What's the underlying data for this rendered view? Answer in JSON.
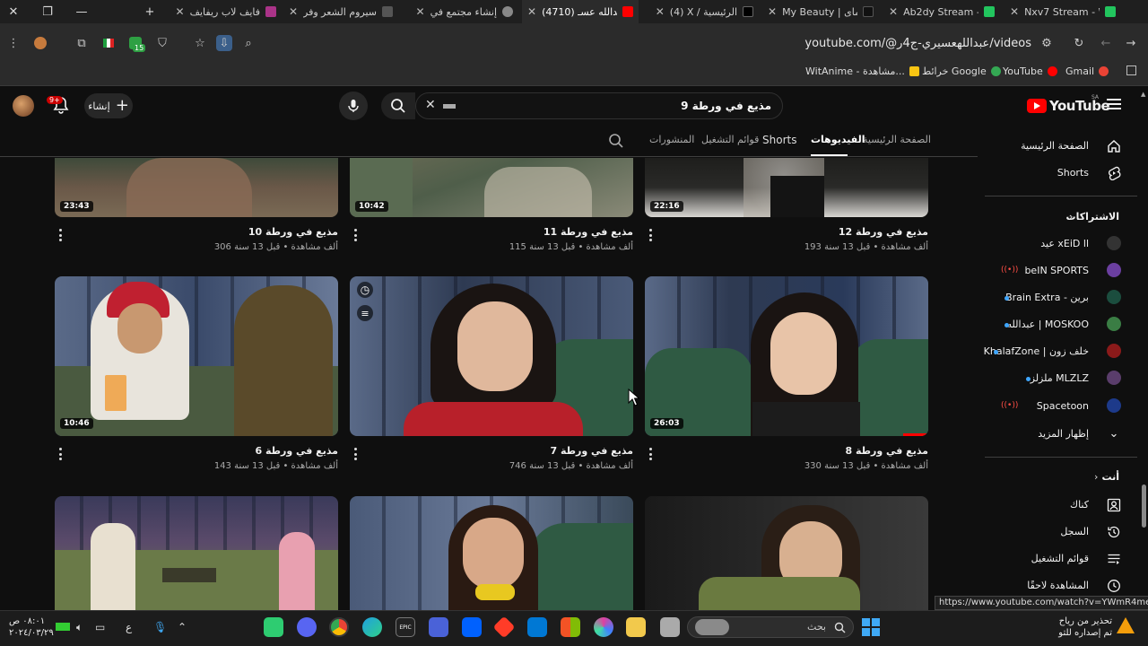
{
  "browser": {
    "tabs": [
      {
        "label": "Nxv7 Stream - W",
        "fav": "#22c55e"
      },
      {
        "label": "Ab2dy Stream -",
        "fav": "#22c55e"
      },
      {
        "label": "My Beauty | مای",
        "fav": "#111111"
      },
      {
        "label": "(4) X / الرئيسية",
        "fav": "#000000"
      },
      {
        "label": "(4710) عبدالله عسـ",
        "fav": "#ff0000",
        "active": true
      },
      {
        "label": "إنشاء مجتمع في",
        "fav": "#888888"
      },
      {
        "label": "سيروم الشعر وفر",
        "fav": "#555555"
      },
      {
        "label": "فايف لاب ريفايف",
        "fav": "#aa3388"
      }
    ],
    "new_tab": "+",
    "url": "youtube.com/@عبداللهعسيري-ج4ر/videos",
    "bookmarks": [
      {
        "label": "Gmail",
        "color": "#ea4335"
      },
      {
        "label": "YouTube",
        "color": "#ff0000"
      },
      {
        "label": "خرائط Google",
        "color": "#34a853"
      },
      {
        "label": "WitAnime - مشاهدة...",
        "color": "#f9c513"
      }
    ],
    "toolbar_badge": "15",
    "status_url": "https://www.youtube.com/watch?v=YWmR4me9Q8o"
  },
  "youtube": {
    "logo_text": "YouTube",
    "logo_region": "SA",
    "search_query": "مذيع في ورطة 9",
    "create_label": "إنشاء",
    "notif_count": "9+",
    "channel_tabs": [
      {
        "label": "الصفحة الرئيسية",
        "active": false
      },
      {
        "label": "الفيديوهات",
        "active": true
      },
      {
        "label": "Shorts",
        "active": false
      },
      {
        "label": "قوائم التشغيل",
        "active": false
      },
      {
        "label": "المنشورات",
        "active": false
      }
    ],
    "videos": [
      {
        "title": "مذيع في ورطة 12",
        "meta": "193 ألف مشاهدة • قبل 13 سنة",
        "duration": "22:16"
      },
      {
        "title": "مذيع في ورطة 11",
        "meta": "115 ألف مشاهدة • قبل 13 سنة",
        "duration": "10:42"
      },
      {
        "title": "مذيع في ورطة 10",
        "meta": "306 ألف مشاهدة • قبل 13 سنة",
        "duration": "23:43"
      },
      {
        "title": "مذيع في ورطة 8",
        "meta": "330 ألف مشاهدة • قبل 13 سنة",
        "duration": "26:03",
        "watched": 0.09
      },
      {
        "title": "مذيع في ورطة 7",
        "meta": "746 ألف مشاهدة • قبل 13 سنة",
        "duration": ""
      },
      {
        "title": "مذيع في ورطة 6",
        "meta": "143 ألف مشاهدة • قبل 13 سنة",
        "duration": "10:46"
      }
    ],
    "sidebar": {
      "main": [
        {
          "label": "الصفحة الرئيسية",
          "icon": "home-icon"
        },
        {
          "label": "Shorts",
          "icon": "shorts-icon"
        }
      ],
      "subs_header": "الاشتراكات",
      "subscriptions": [
        {
          "label": "عيد xEiD ll",
          "color": "#333333",
          "status": ""
        },
        {
          "label": "beIN SPORTS",
          "color": "#6b3fa0",
          "status": "live"
        },
        {
          "label": "Brain Extra - برين",
          "color": "#1b4d3e",
          "status": "new"
        },
        {
          "label": "عبدالله | MOSKOO",
          "color": "#3a7d44",
          "status": "new"
        },
        {
          "label": "KhalafZone | خلف زون",
          "color": "#8b1a1a",
          "status": "new"
        },
        {
          "label": "ملزلز MLZLZ",
          "color": "#5a3d6b",
          "status": "new"
        },
        {
          "label": "Spacetoon",
          "color": "#1d3a8a",
          "status": "live"
        }
      ],
      "show_more": "إظهار المزيد",
      "you_header": "أنت",
      "you_items": [
        {
          "label": "كناك",
          "icon": "account-icon"
        },
        {
          "label": "السجل",
          "icon": "history-icon"
        },
        {
          "label": "قوائم التشغيل",
          "icon": "playlists-icon"
        },
        {
          "label": "المشاهدة لاحقًا",
          "icon": "watch-later-icon"
        }
      ]
    }
  },
  "taskbar": {
    "search_placeholder": "بحث",
    "clock_time": "٠٨:٠١ ص",
    "clock_date": "٢٠٢٤/٠٣/٢٩",
    "weather_line1": "تحذير من رياح",
    "weather_line2": "تم إصداره للتو",
    "lang": "ع"
  }
}
